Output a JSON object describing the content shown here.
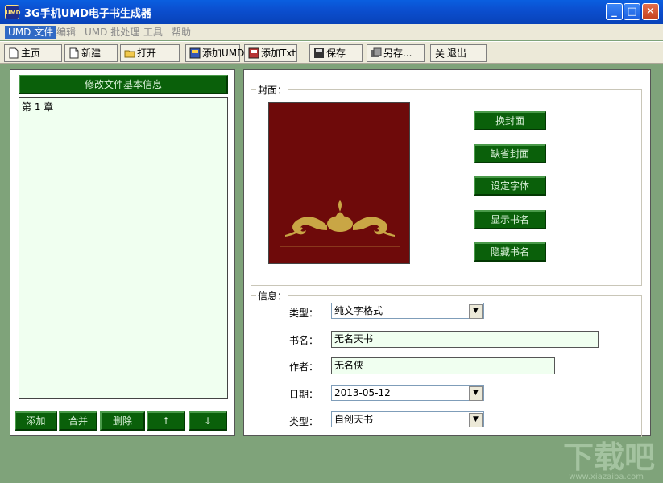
{
  "window": {
    "icon_text": "UMD",
    "title": "3G手机UMD电子书生成器",
    "minimize": "_",
    "maximize": "□",
    "close": "✕"
  },
  "menu": [
    "UMD 文件",
    "编辑",
    "UMD 批处理",
    "工具",
    "帮助"
  ],
  "toolbar": [
    {
      "label": "主页",
      "icon": "page-icon"
    },
    {
      "label": "新建",
      "icon": "new-file-icon"
    },
    {
      "label": "打开",
      "icon": "open-folder-icon"
    },
    {
      "label": "添加UMD",
      "icon": "add-umd-icon"
    },
    {
      "label": "添加Txt",
      "icon": "add-txt-icon"
    },
    {
      "label": "保存",
      "icon": "save-disk-icon"
    },
    {
      "label": "另存...",
      "icon": "save-as-icon"
    },
    {
      "label": "退出",
      "icon": "exit-icon"
    }
  ],
  "left": {
    "header_button": "修改文件基本信息",
    "chapters": [
      "第 1 章"
    ],
    "buttons": [
      "添加",
      "合并",
      "删除",
      "↑",
      "↓"
    ]
  },
  "cover": {
    "legend": "封面：",
    "buttons": [
      "换封面",
      "缺省封面",
      "设定字体",
      "显示书名",
      "隐藏书名"
    ]
  },
  "info": {
    "legend": "信息：",
    "type_label": "类型：",
    "type_value": "纯文字格式",
    "name_label": "书名：",
    "name_value": "无名天书",
    "author_label": "作者：",
    "author_value": "无名侠",
    "date_label": "日期：",
    "date_value": "2013-05-12",
    "category_label": "类型：",
    "category_value": "自创天书"
  },
  "watermark": {
    "main": "下载吧",
    "sub": "www.xiazaiba.com"
  }
}
